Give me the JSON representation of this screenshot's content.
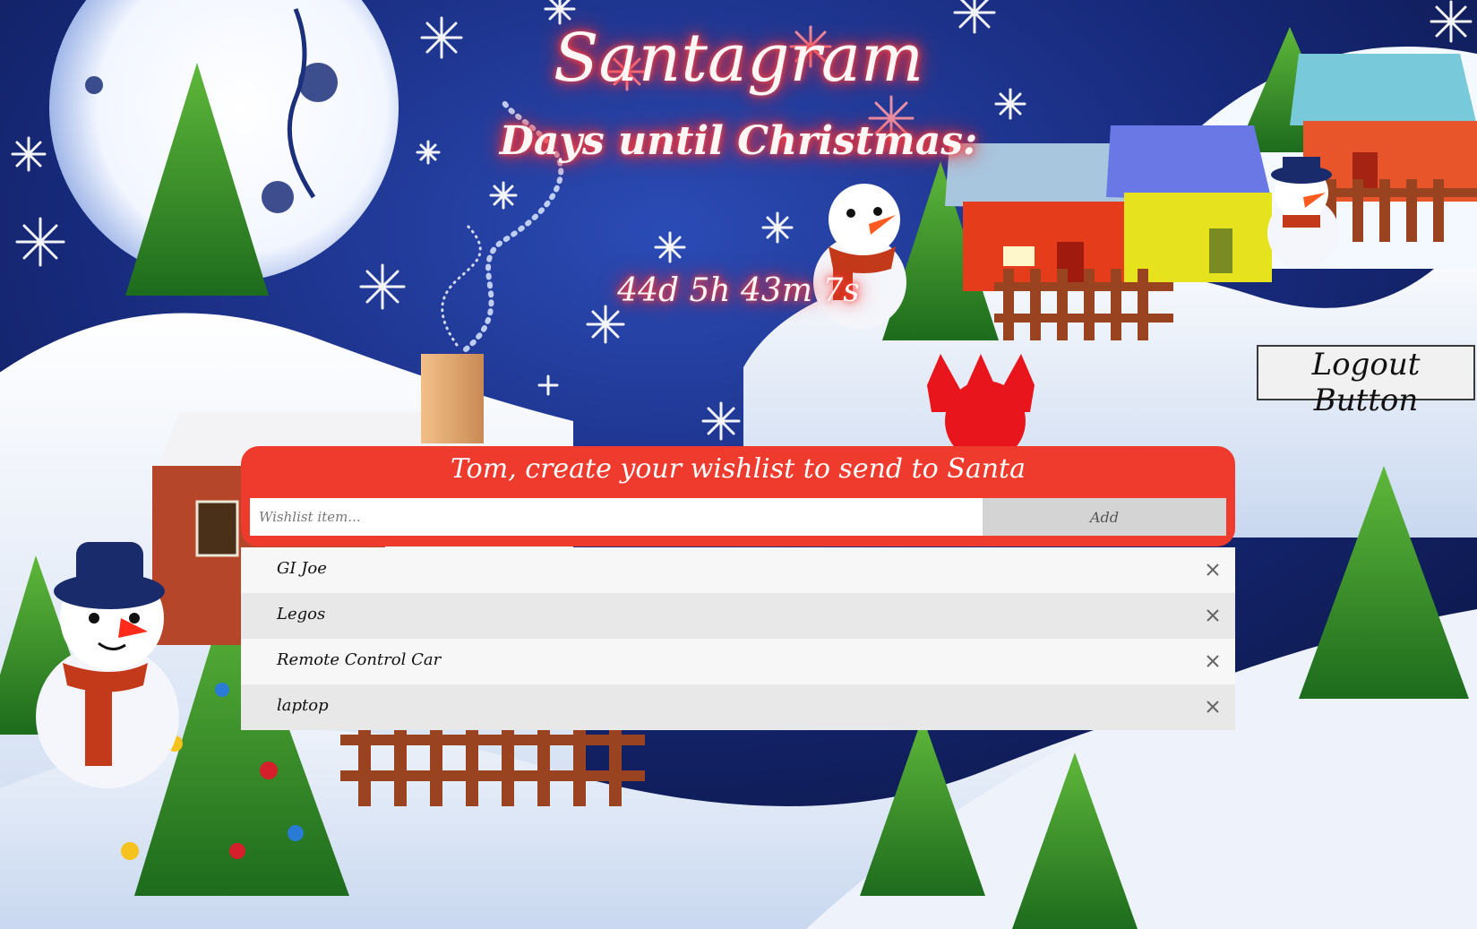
{
  "app": {
    "title": "Santagram"
  },
  "countdown": {
    "label": "Days until Christmas:",
    "value": "44d 5h 43m 7s"
  },
  "logout": {
    "label": "Logout Button"
  },
  "wishlist": {
    "heading": "Tom, create your wishlist to send to Santa",
    "input_placeholder": "Wishlist item...",
    "input_value": "",
    "add_label": "Add",
    "items": [
      {
        "text": "GI Joe",
        "remove_icon": "close-icon"
      },
      {
        "text": "Legos",
        "remove_icon": "close-icon"
      },
      {
        "text": "Remote Control Car",
        "remove_icon": "close-icon"
      },
      {
        "text": "laptop",
        "remove_icon": "close-icon"
      }
    ]
  },
  "colors": {
    "header_red": "#ef3b2d",
    "title_glow": "#ff2d2d",
    "night_sky": "#0f1c55",
    "snow": "#ffffff"
  }
}
